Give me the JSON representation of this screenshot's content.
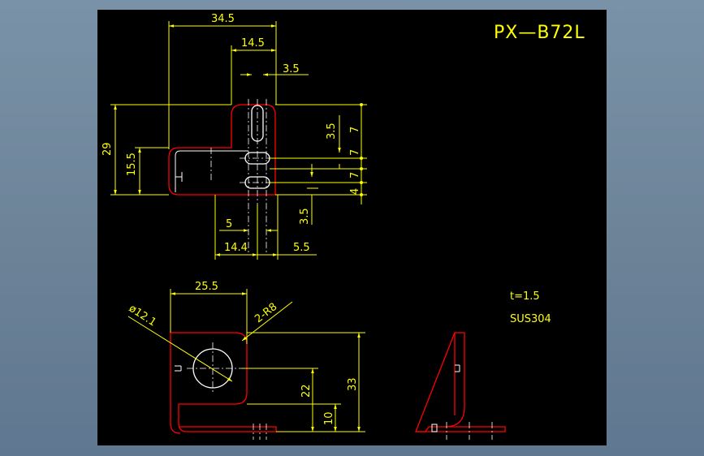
{
  "title": "PX—B72L",
  "material": {
    "thickness": "t=1.5",
    "grade": "SUS304"
  },
  "top_view": {
    "dim_34_5": "34.5",
    "dim_14_5": "14.5",
    "dim_3_5_top": "3.5",
    "dim_29": "29",
    "dim_15_5": "15.5",
    "dim_5": "5",
    "dim_3_5_bottom": "3.5",
    "dim_14_4": "14.4",
    "dim_5_5": "5.5",
    "dim_3_5_right": "3.5",
    "dim_7_a": "7",
    "dim_7_b": "7",
    "dim_7_c": "7",
    "dim_4": "4"
  },
  "front_view": {
    "dim_25_5": "25.5",
    "hole_dia": "ø12.1",
    "radius": "2-R8",
    "dim_22": "22",
    "dim_10": "10",
    "dim_33": "33"
  },
  "colors": {
    "canvas": "#000000",
    "outline": "#ff0000",
    "dimension": "#ffff00",
    "centerline": "#ffffff",
    "frame": "#6f869b"
  }
}
